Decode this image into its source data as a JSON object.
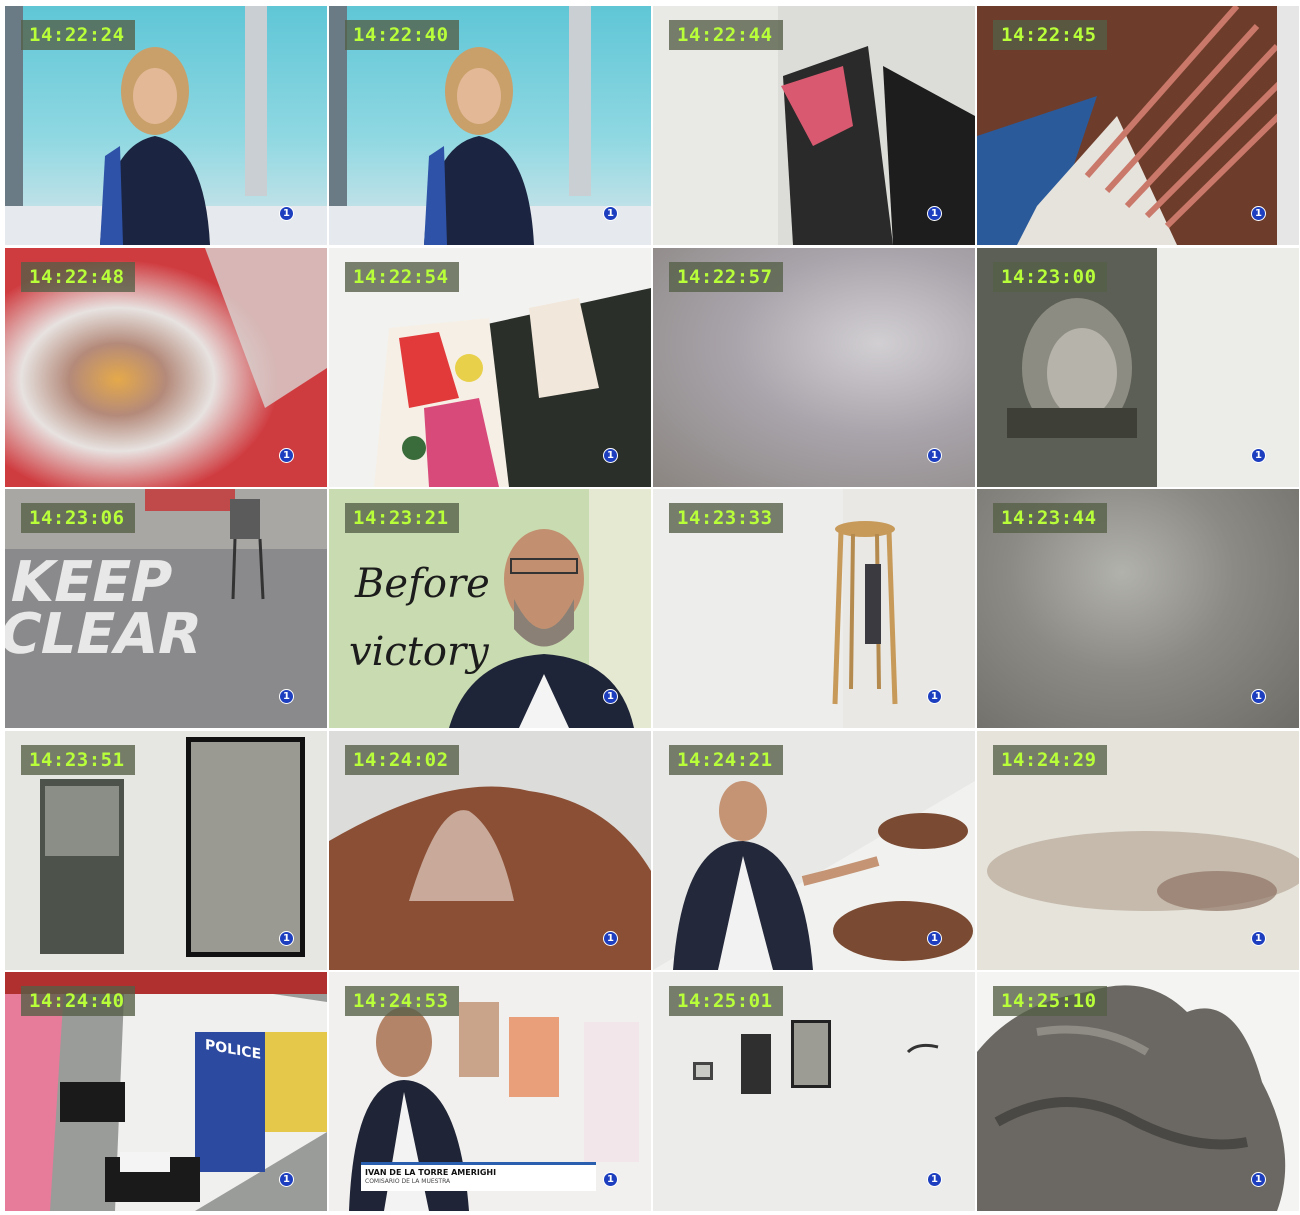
{
  "channel_logo_glyph": "1",
  "frames": [
    {
      "timestamp": "14:22:24"
    },
    {
      "timestamp": "14:22:40"
    },
    {
      "timestamp": "14:22:44"
    },
    {
      "timestamp": "14:22:45"
    },
    {
      "timestamp": "14:22:48"
    },
    {
      "timestamp": "14:22:54"
    },
    {
      "timestamp": "14:22:57"
    },
    {
      "timestamp": "14:23:00"
    },
    {
      "timestamp": "14:23:06",
      "text": "KEEP CLEAR"
    },
    {
      "timestamp": "14:23:21",
      "text_line1": "Before",
      "text_line2": "victory"
    },
    {
      "timestamp": "14:23:33"
    },
    {
      "timestamp": "14:23:44"
    },
    {
      "timestamp": "14:23:51"
    },
    {
      "timestamp": "14:24:02"
    },
    {
      "timestamp": "14:24:21"
    },
    {
      "timestamp": "14:24:29"
    },
    {
      "timestamp": "14:24:40",
      "sign": "POLICE"
    },
    {
      "timestamp": "14:24:53",
      "caption_name": "IVAN DE LA TORRE AMERIGHI",
      "caption_role": "COMISARIO DE LA MUESTRA"
    },
    {
      "timestamp": "14:25:01"
    },
    {
      "timestamp": "14:25:10"
    }
  ]
}
